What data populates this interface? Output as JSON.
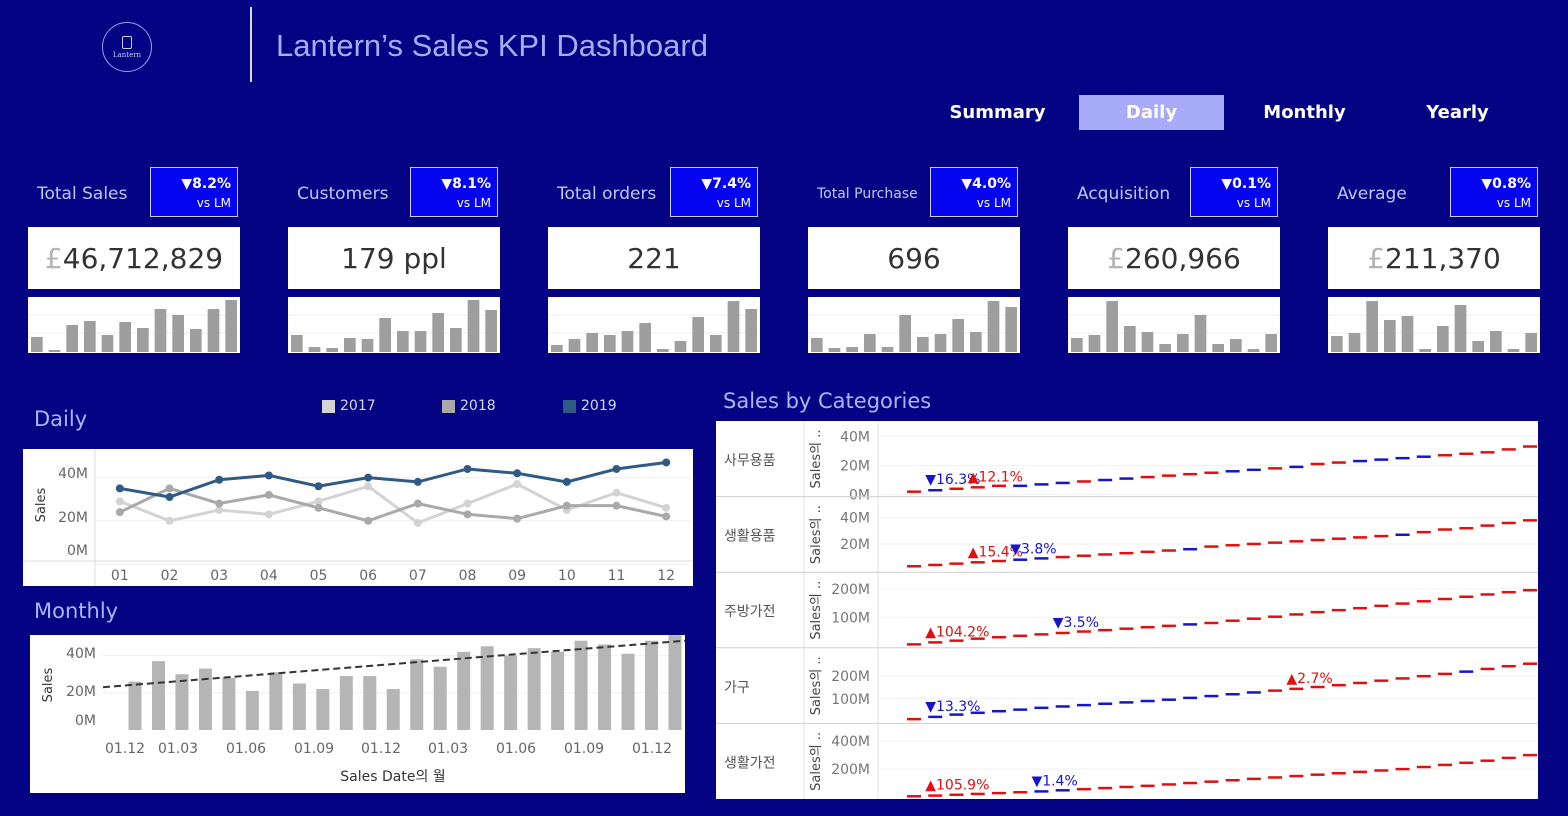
{
  "header": {
    "title": "Lantern’s Sales KPI Dashboard",
    "logo_text": "Lantern"
  },
  "nav": {
    "items": [
      "Summary",
      "Daily",
      "Monthly",
      "Yearly"
    ],
    "active": "Daily"
  },
  "kpis": [
    {
      "label": "Total Sales",
      "delta": "▼8.2%",
      "vs": "vs LM",
      "currency": "£",
      "value": "46,712,829",
      "spark": [
        15,
        2,
        27,
        31,
        17,
        30,
        24,
        43,
        37,
        23,
        43,
        52
      ]
    },
    {
      "label": "Customers",
      "delta": "▼8.1%",
      "vs": "vs LM",
      "currency": "",
      "value": "179 ppl",
      "spark": [
        17,
        5,
        4,
        14,
        13,
        34,
        21,
        21,
        39,
        24,
        52,
        42
      ]
    },
    {
      "label": "Total orders",
      "delta": "▼7.4%",
      "vs": "vs LM",
      "currency": "",
      "value": "221",
      "spark": [
        7,
        13,
        19,
        17,
        21,
        29,
        3,
        11,
        35,
        17,
        51,
        43
      ]
    },
    {
      "label": "Total Purchase",
      "delta": "▼4.0%",
      "vs": "vs LM",
      "currency": "",
      "value": "696",
      "spark": [
        14,
        4,
        5,
        18,
        5,
        37,
        15,
        18,
        33,
        20,
        51,
        45
      ]
    },
    {
      "label": "Acquisition",
      "delta": "▼0.1%",
      "vs": "vs LM",
      "currency": "£",
      "value": "260,966",
      "spark": [
        14,
        17,
        51,
        26,
        20,
        8,
        18,
        37,
        8,
        13,
        3,
        18
      ]
    },
    {
      "label": "Average",
      "delta": "▼0.8%",
      "vs": "vs LM",
      "currency": "£",
      "value": "211,370",
      "spark": [
        16,
        19,
        51,
        32,
        36,
        3,
        26,
        47,
        11,
        21,
        3,
        19
      ]
    }
  ],
  "daily": {
    "title": "Daily",
    "legend": [
      "2017",
      "2018",
      "2019"
    ],
    "chart_data": {
      "type": "line",
      "ylabel": "Sales",
      "yticks": [
        "40M",
        "20M",
        "0M"
      ],
      "ylim": [
        0,
        50
      ],
      "categories": [
        "01",
        "02",
        "03",
        "04",
        "05",
        "06",
        "07",
        "08",
        "09",
        "10",
        "11",
        "12"
      ],
      "series": [
        {
          "name": "2017",
          "color": "#d3d3d3",
          "values": [
            29,
            20,
            25,
            23,
            29,
            36,
            19,
            28,
            37,
            25,
            33,
            26
          ]
        },
        {
          "name": "2018",
          "color": "#a9a9a9",
          "values": [
            24,
            35,
            28,
            32,
            26,
            20,
            28,
            23,
            21,
            27,
            27,
            22
          ]
        },
        {
          "name": "2019",
          "color": "#2e5a84",
          "values": [
            35,
            31,
            39,
            41,
            36,
            40,
            38,
            44,
            42,
            38,
            44,
            47
          ]
        }
      ]
    }
  },
  "monthly": {
    "title": "Monthly",
    "chart_data": {
      "type": "bar",
      "ylabel": "Sales",
      "xlabel": "Sales Date의 월",
      "yticks": [
        "40M",
        "20M",
        "0M"
      ],
      "ylim": [
        0,
        50
      ],
      "xticks": [
        "01.12",
        "01.03",
        "01.06",
        "01.09",
        "01.12",
        "01.03",
        "01.06",
        "01.09",
        "01.12"
      ],
      "values": [
        26,
        37,
        30,
        33,
        28,
        21,
        31,
        25,
        22,
        29,
        29,
        22,
        38,
        34,
        42,
        45,
        40,
        44,
        42,
        48,
        46,
        41,
        48,
        51
      ],
      "trend": [
        23,
        48
      ]
    }
  },
  "categories_panel": {
    "title": "Sales by Categories",
    "ylabel": "Sales의 ..",
    "rows": [
      {
        "name": "사무용품",
        "yticks": [
          "40M",
          "20M",
          "0M"
        ],
        "ylim": [
          0,
          45
        ],
        "values": [
          2,
          3,
          4,
          5,
          6,
          6,
          7,
          8,
          9,
          10,
          11,
          12,
          13,
          14,
          15,
          16,
          17,
          18,
          19,
          21,
          22,
          23,
          24,
          25,
          26,
          27,
          28,
          29,
          31,
          33
        ],
        "colors": "RBRRRBBBRBBRRRRBBRBRRBBBBRRRRR",
        "labels": [
          {
            "text": "▼16.3%",
            "index": 1,
            "dir": "down"
          },
          {
            "text": "▲12.1%",
            "index": 3,
            "dir": "up"
          }
        ]
      },
      {
        "name": "생활용품",
        "yticks": [
          "40M",
          "20M"
        ],
        "ylim": [
          0,
          50
        ],
        "values": [
          3,
          4,
          5,
          6,
          7,
          8,
          9,
          10,
          11,
          12,
          13,
          14,
          15,
          16,
          18,
          19,
          20,
          21,
          22,
          23,
          24,
          25,
          26,
          27,
          29,
          31,
          32,
          34,
          36,
          38
        ],
        "colors": "RRRRRBBRRRRRRBRRRRRRRRRBRRRRRR",
        "labels": [
          {
            "text": "▲15.4%",
            "index": 3,
            "dir": "up"
          },
          {
            "text": "▼3.8%",
            "index": 5,
            "dir": "down"
          }
        ]
      },
      {
        "name": "주방가전",
        "yticks": [
          "200M",
          "100M"
        ],
        "ylim": [
          0,
          230
        ],
        "values": [
          5,
          12,
          18,
          25,
          30,
          35,
          40,
          45,
          50,
          55,
          60,
          65,
          70,
          75,
          80,
          88,
          95,
          102,
          110,
          118,
          125,
          132,
          140,
          148,
          156,
          164,
          172,
          180,
          188,
          195
        ],
        "colors": "RRRRRRRRRRRRRBRRRRRRRRRRRRRRRR",
        "labels": [
          {
            "text": "▲104.2%",
            "index": 1,
            "dir": "up"
          },
          {
            "text": "▼3.5%",
            "index": 7,
            "dir": "down"
          }
        ]
      },
      {
        "name": "가구",
        "yticks": [
          "200M",
          "100M"
        ],
        "ylim": [
          0,
          290
        ],
        "values": [
          10,
          20,
          30,
          38,
          45,
          52,
          60,
          66,
          72,
          78,
          84,
          90,
          96,
          104,
          112,
          120,
          128,
          136,
          144,
          152,
          160,
          170,
          180,
          190,
          200,
          210,
          220,
          232,
          244,
          255
        ],
        "colors": "RBBBBBBBBBBBBBBBBRRRRRRRRRBRRR",
        "labels": [
          {
            "text": "▼13.3%",
            "index": 1,
            "dir": "down"
          },
          {
            "text": "▲2.7%",
            "index": 18,
            "dir": "up"
          }
        ]
      },
      {
        "name": "생활가전",
        "yticks": [
          "400M",
          "200M"
        ],
        "ylim": [
          0,
          470
        ],
        "values": [
          5,
          10,
          16,
          22,
          28,
          34,
          40,
          48,
          56,
          64,
          72,
          80,
          90,
          100,
          110,
          120,
          130,
          140,
          150,
          160,
          170,
          180,
          190,
          200,
          215,
          230,
          245,
          260,
          280,
          300
        ],
        "colors": "RRRRRRBBRRRRRRRRRRRRRRRRRRRRRR",
        "labels": [
          {
            "text": "▲105.9%",
            "index": 1,
            "dir": "up"
          },
          {
            "text": "▼1.4%",
            "index": 6,
            "dir": "down"
          }
        ]
      }
    ],
    "colors": {
      "up": "#e01010",
      "down": "#1515cc"
    }
  }
}
